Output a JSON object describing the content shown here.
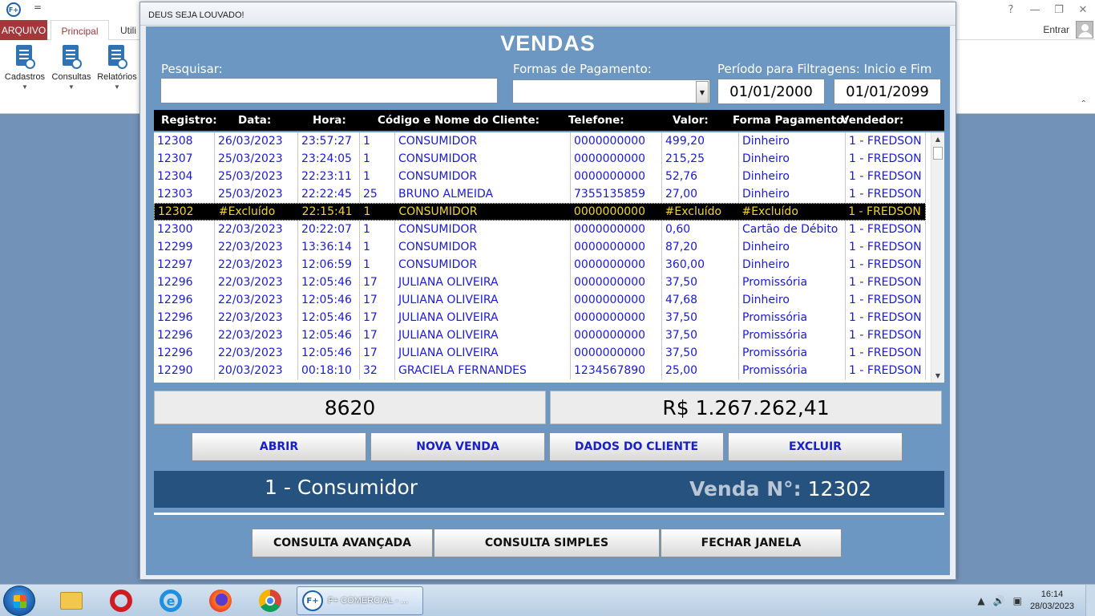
{
  "access": {
    "qat_label": "=",
    "tabs": {
      "arquivo": "ARQUIVO",
      "principal": "Principal",
      "util": "Utili"
    },
    "entrar": "Entrar",
    "ribbon_buttons": [
      {
        "label": "Cadastros",
        "icon": "add-document-icon"
      },
      {
        "label": "Consultas",
        "icon": "search-document-icon"
      },
      {
        "label": "Relatórios",
        "icon": "report-icon"
      }
    ],
    "window_buttons": {
      "help": "?",
      "minimize": "—",
      "restore": "❐",
      "close": "✕"
    }
  },
  "dialog": {
    "title": "DEUS SEJA LOUVADO!",
    "heading": "VENDAS",
    "search": {
      "label": "Pesquisar:",
      "value": ""
    },
    "payment": {
      "label": "Formas de Pagamento:",
      "value": ""
    },
    "period": {
      "label": "Período para Filtragens: Inicio e Fim",
      "start": "01/01/2000",
      "end": "01/01/2099"
    },
    "columns": [
      "Registro:",
      "Data:",
      "Hora:",
      "Código e Nome do Cliente:",
      "Telefone:",
      "Valor:",
      "Forma Pagamento:",
      "Vendedor:"
    ],
    "rows": [
      [
        "12308",
        "26/03/2023",
        "23:57:27",
        "1",
        "CONSUMIDOR",
        "0000000000",
        "499,20",
        "Dinheiro",
        "1 - FREDSON"
      ],
      [
        "12307",
        "25/03/2023",
        "23:24:05",
        "1",
        "CONSUMIDOR",
        "0000000000",
        "215,25",
        "Dinheiro",
        "1 - FREDSON"
      ],
      [
        "12304",
        "25/03/2023",
        "22:23:11",
        "1",
        "CONSUMIDOR",
        "0000000000",
        "52,76",
        "Dinheiro",
        "1 - FREDSON"
      ],
      [
        "12303",
        "25/03/2023",
        "22:22:45",
        "25",
        "BRUNO ALMEIDA",
        "7355135859",
        "27,00",
        "Dinheiro",
        "1 - FREDSON"
      ],
      [
        "12302",
        "#Excluído",
        "22:15:41",
        "1",
        "CONSUMIDOR",
        "0000000000",
        "#Excluído",
        "#Excluído",
        "1 - FREDSON"
      ],
      [
        "12300",
        "22/03/2023",
        "20:22:07",
        "1",
        "CONSUMIDOR",
        "0000000000",
        "0,60",
        "Cartão de Débito",
        "1 - FREDSON"
      ],
      [
        "12299",
        "22/03/2023",
        "13:36:14",
        "1",
        "CONSUMIDOR",
        "0000000000",
        "87,20",
        "Dinheiro",
        "1 - FREDSON"
      ],
      [
        "12297",
        "22/03/2023",
        "12:06:59",
        "1",
        "CONSUMIDOR",
        "0000000000",
        "360,00",
        "Dinheiro",
        "1 - FREDSON"
      ],
      [
        "12296",
        "22/03/2023",
        "12:05:46",
        "17",
        "JULIANA OLIVEIRA",
        "0000000000",
        "37,50",
        "Promissória",
        "1 - FREDSON"
      ],
      [
        "12296",
        "22/03/2023",
        "12:05:46",
        "17",
        "JULIANA OLIVEIRA",
        "0000000000",
        "47,68",
        "Dinheiro",
        "1 - FREDSON"
      ],
      [
        "12296",
        "22/03/2023",
        "12:05:46",
        "17",
        "JULIANA OLIVEIRA",
        "0000000000",
        "37,50",
        "Promissória",
        "1 - FREDSON"
      ],
      [
        "12296",
        "22/03/2023",
        "12:05:46",
        "17",
        "JULIANA OLIVEIRA",
        "0000000000",
        "37,50",
        "Promissória",
        "1 - FREDSON"
      ],
      [
        "12296",
        "22/03/2023",
        "12:05:46",
        "17",
        "JULIANA OLIVEIRA",
        "0000000000",
        "37,50",
        "Promissória",
        "1 - FREDSON"
      ],
      [
        "12290",
        "20/03/2023",
        "00:18:10",
        "32",
        "GRACIELA FERNANDES",
        "1234567890",
        "25,00",
        "Promissória",
        "1 - FREDSON"
      ]
    ],
    "selected_row_index": 4,
    "total_count": "8620",
    "total_value": "R$ 1.267.262,41",
    "buttons": {
      "abrir": "ABRIR",
      "nova_venda": "NOVA VENDA",
      "dados_cliente": "DADOS DO CLIENTE",
      "excluir": "EXCLUIR",
      "consulta_avancada": "CONSULTA AVANÇADA",
      "consulta_simples": "CONSULTA SIMPLES",
      "fechar": "FECHAR JANELA"
    },
    "info": {
      "cliente": "1 - Consumidor",
      "venda_label": "Venda N°:",
      "venda_numero": "12302"
    }
  },
  "taskbar": {
    "task_label": "F+ COMERCIAL - ...",
    "time": "16:14",
    "date": "28/03/2023"
  },
  "colors": {
    "dialog_bg": "#6d97c3",
    "row_text": "#1a1ad6",
    "selected_text": "#f1d431",
    "info_bar": "#25527f"
  }
}
